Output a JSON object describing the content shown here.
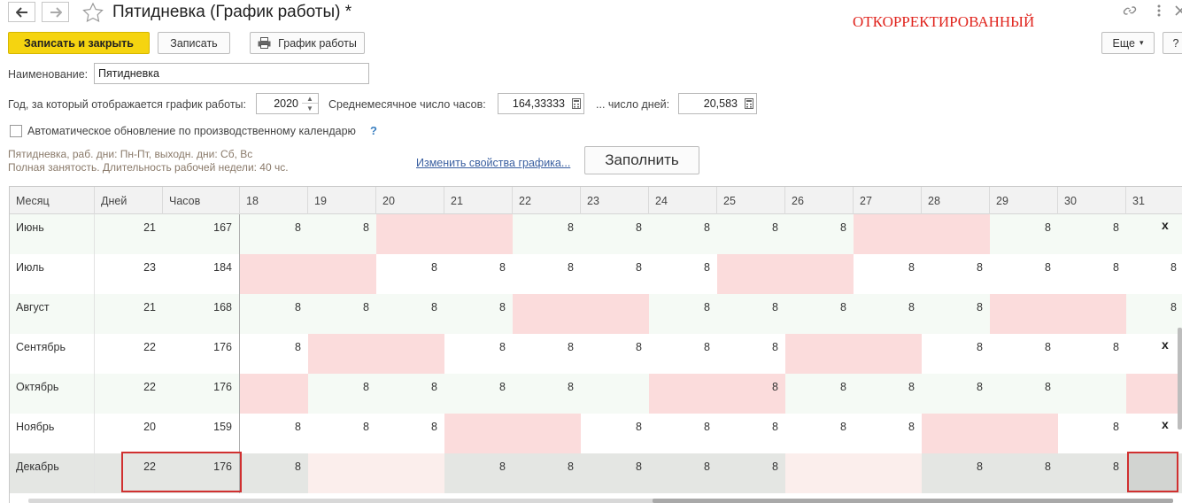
{
  "window": {
    "title": "Пятидневка (График работы) *",
    "watermark": "ОТКОРРЕКТИРОВАННЫЙ",
    "icons": [
      "back-arrow-icon",
      "forward-arrow-icon",
      "star-icon",
      "link-icon",
      "menu-dots-icon",
      "close-icon"
    ]
  },
  "toolbar": {
    "save_close_label": "Записать и закрыть",
    "save_label": "Записать",
    "schedule_label": "График работы",
    "more_label": "Еще",
    "more_arrow": "▾",
    "help_label": "?"
  },
  "form": {
    "name_label": "Наименование:",
    "name_value": "Пятидневка",
    "year_label": "Год, за который отображается график работы:",
    "year_value": "2020",
    "avg_hours_label": "Среднемесячное число часов:",
    "avg_hours_value": "164,33333",
    "avg_days_label": "... число дней:",
    "avg_days_value": "20,583",
    "auto_update_label": "Автоматическое обновление по производственному календарю",
    "auto_update_checked": false,
    "help_mark": "?",
    "info_line1": "Пятидневка, раб. дни: Пн-Пт, выходн. дни: Сб, Вс",
    "info_line2": "Полная занятость. Длительность рабочей недели: 40 чс.",
    "change_props_link": "Изменить свойства графика...",
    "fill_button": "Заполнить"
  },
  "table": {
    "headers": {
      "month": "Месяц",
      "days": "Дней",
      "hours": "Часов",
      "day_numbers": [
        "18",
        "19",
        "20",
        "21",
        "22",
        "23",
        "24",
        "25",
        "26",
        "27",
        "28",
        "29",
        "30",
        "31"
      ]
    },
    "rows": [
      {
        "month": "Июнь",
        "days": "21",
        "hours": "167",
        "cells": [
          "8",
          "8",
          "",
          "",
          "8",
          "8",
          "8",
          "8",
          "8",
          "",
          "",
          "8",
          "8",
          ""
        ],
        "weekend": [
          2,
          3,
          9,
          10
        ],
        "end_mark": "x"
      },
      {
        "month": "Июль",
        "days": "23",
        "hours": "184",
        "cells": [
          "",
          "",
          "8",
          "8",
          "8",
          "8",
          "8",
          "",
          "",
          "8",
          "8",
          "8",
          "8",
          "8"
        ],
        "weekend": [
          0,
          1,
          7,
          8
        ],
        "end_mark": ""
      },
      {
        "month": "Август",
        "days": "21",
        "hours": "168",
        "cells": [
          "8",
          "8",
          "8",
          "8",
          "",
          "",
          "8",
          "8",
          "8",
          "8",
          "8",
          "",
          "",
          "8"
        ],
        "weekend": [
          4,
          5,
          11,
          12
        ],
        "end_mark": ""
      },
      {
        "month": "Сентябрь",
        "days": "22",
        "hours": "176",
        "cells": [
          "8",
          "",
          "",
          "8",
          "8",
          "8",
          "8",
          "8",
          "",
          "",
          "8",
          "8",
          "8",
          ""
        ],
        "weekend": [
          1,
          2,
          8,
          9
        ],
        "end_mark": "x"
      },
      {
        "month": "Октябрь",
        "days": "22",
        "hours": "176",
        "cells": [
          "",
          "8",
          "8",
          "8",
          "8",
          "",
          "",
          "8",
          "8",
          "8",
          "8",
          "8",
          "",
          ""
        ],
        "weekend": [
          0,
          6,
          7,
          13
        ],
        "end_mark": ""
      },
      {
        "month": "Ноябрь",
        "days": "20",
        "hours": "159",
        "cells": [
          "8",
          "8",
          "8",
          "",
          "",
          "8",
          "8",
          "8",
          "8",
          "8",
          "",
          "",
          "8",
          ""
        ],
        "weekend": [
          3,
          4,
          10,
          11
        ],
        "end_mark": "x"
      },
      {
        "month": "Декабрь",
        "days": "22",
        "hours": "176",
        "cells": [
          "8",
          "",
          "",
          "8",
          "8",
          "8",
          "8",
          "8",
          "",
          "",
          "8",
          "8",
          "8",
          ""
        ],
        "weekend": [
          1,
          2,
          8,
          9
        ],
        "end_mark": ""
      }
    ]
  },
  "colors": {
    "accent_yellow": "#f5d410",
    "weekend_pink": "#fbdcdc",
    "selected_row": "#e4e6e3",
    "selected_weekend": "#fbeeec",
    "highlight_red": "#d03030",
    "row_alt": "#f5faf5"
  }
}
